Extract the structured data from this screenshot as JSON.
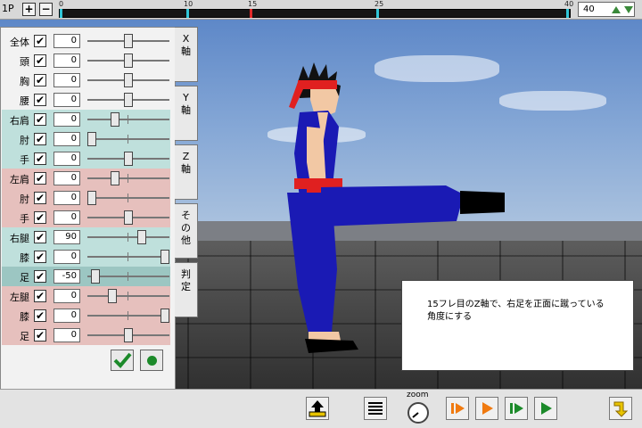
{
  "topbar": {
    "player": "1P",
    "plus": "+",
    "minus": "−",
    "timeline_ticks": [
      "0",
      "10",
      "15",
      "25",
      "40"
    ],
    "frame_value": "40"
  },
  "tabs": [
    "X軸",
    "Y軸",
    "Z軸",
    "その他",
    "判定"
  ],
  "joints": [
    {
      "label": "全体",
      "checked": "✔",
      "value": "0",
      "level": 0.5,
      "group": "plain"
    },
    {
      "label": "頭",
      "checked": "✔",
      "value": "0",
      "level": 0.5,
      "group": "plain"
    },
    {
      "label": "胸",
      "checked": "✔",
      "value": "0",
      "level": 0.5,
      "group": "plain"
    },
    {
      "label": "腰",
      "checked": "✔",
      "value": "0",
      "level": 0.5,
      "group": "plain"
    },
    {
      "label": "右肩",
      "checked": "✔",
      "value": "0",
      "level": 0.32,
      "group": "cyan"
    },
    {
      "label": "肘",
      "checked": "✔",
      "value": "0",
      "level": 0.0,
      "group": "cyan"
    },
    {
      "label": "手",
      "checked": "✔",
      "value": "0",
      "level": 0.5,
      "group": "cyan"
    },
    {
      "label": "左肩",
      "checked": "✔",
      "value": "0",
      "level": 0.32,
      "group": "pink"
    },
    {
      "label": "肘",
      "checked": "✔",
      "value": "0",
      "level": 0.0,
      "group": "pink"
    },
    {
      "label": "手",
      "checked": "✔",
      "value": "0",
      "level": 0.5,
      "group": "pink"
    },
    {
      "label": "右腿",
      "checked": "✔",
      "value": "90",
      "level": 0.68,
      "group": "cyan"
    },
    {
      "label": "膝",
      "checked": "✔",
      "value": "0",
      "level": 1.0,
      "group": "cyan"
    },
    {
      "label": "足",
      "checked": "✔",
      "value": "-50",
      "level": 0.05,
      "group": "dark"
    },
    {
      "label": "左腿",
      "checked": "✔",
      "value": "0",
      "level": 0.28,
      "group": "pink"
    },
    {
      "label": "膝",
      "checked": "✔",
      "value": "0",
      "level": 1.0,
      "group": "pink"
    },
    {
      "label": "足",
      "checked": "✔",
      "value": "0",
      "level": 0.5,
      "group": "pink"
    }
  ],
  "info": {
    "line1": "15フレ目のZ軸で、右足を正面に蹴っている",
    "line2": "角度にする"
  },
  "bottombar": {
    "zoom_label": "zoom"
  },
  "colors": {
    "accent_green": "#1c8a2a",
    "play_orange": "#f07a10",
    "tick_cyan": "#2fc6d8",
    "tick_red": "#e02a2a"
  }
}
